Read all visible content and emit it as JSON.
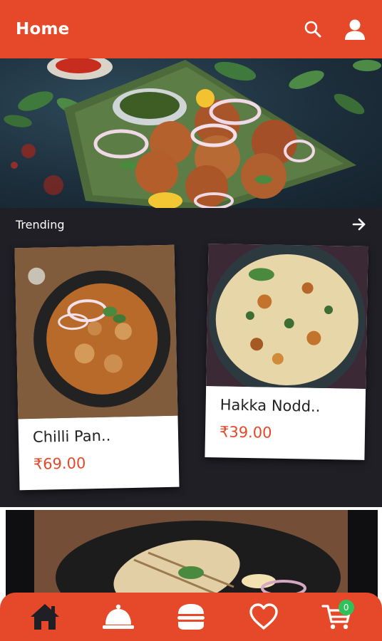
{
  "appbar": {
    "title": "Home",
    "search_icon": "search-icon",
    "profile_icon": "user-icon"
  },
  "trending": {
    "title": "Trending",
    "arrow_icon": "arrow-right-icon",
    "items": [
      {
        "name": "Chilli Pan..",
        "price": "₹69.00"
      },
      {
        "name": "Hakka Nodd..",
        "price": "₹39.00"
      }
    ]
  },
  "bottom_nav": {
    "items": [
      {
        "icon": "home-icon"
      },
      {
        "icon": "serving-bell-icon"
      },
      {
        "icon": "burger-icon"
      },
      {
        "icon": "heart-icon"
      },
      {
        "icon": "cart-icon"
      }
    ],
    "cart_count": "0"
  },
  "colors": {
    "accent": "#E5492A",
    "dark_bg": "#1f1f25",
    "badge": "#2fc25b"
  }
}
